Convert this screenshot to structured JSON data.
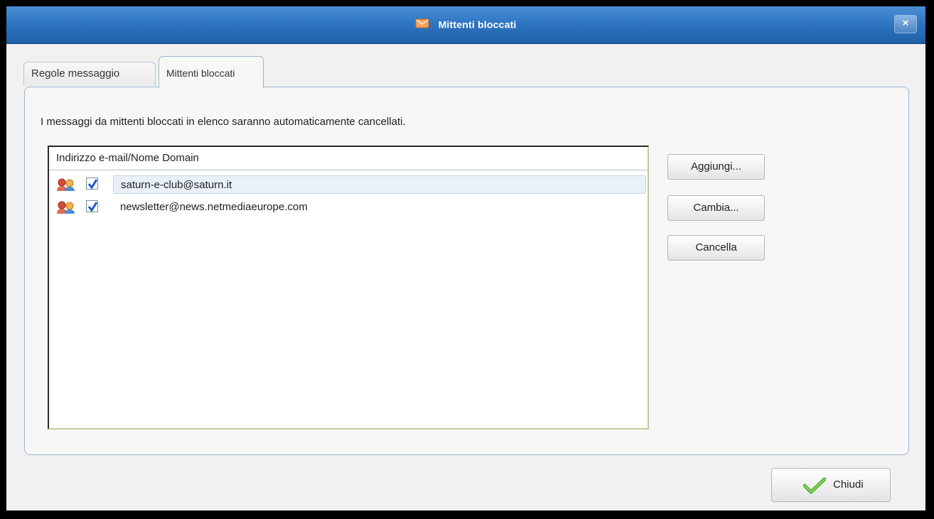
{
  "window": {
    "title": "Mittenti bloccati",
    "close_label": "×"
  },
  "tabs": [
    {
      "label": "Regole messaggio"
    },
    {
      "label": "Mittenti bloccati"
    }
  ],
  "panel": {
    "description": "I messaggi da mittenti bloccati in elenco  saranno automaticamente cancellati.",
    "list_header": "Indirizzo e-mail/Nome Domain",
    "rows": [
      {
        "email": "saturn-e-club@saturn.it",
        "checked": true,
        "selected": true
      },
      {
        "email": "newsletter@news.netmediaeurope.com",
        "checked": true,
        "selected": false
      }
    ]
  },
  "buttons": {
    "add": "Aggiungi...",
    "change": "Cambia...",
    "delete": "Cancella",
    "close": "Chiudi"
  },
  "icons": {
    "title": "envelope-icon",
    "row": "blocked-contacts-icon",
    "check": "checkmark-icon"
  },
  "colors": {
    "titlebar": "#2f76c2",
    "selection": "#e9f0f8",
    "check_blue": "#1d58c8",
    "check_green": "#4caf2f"
  }
}
